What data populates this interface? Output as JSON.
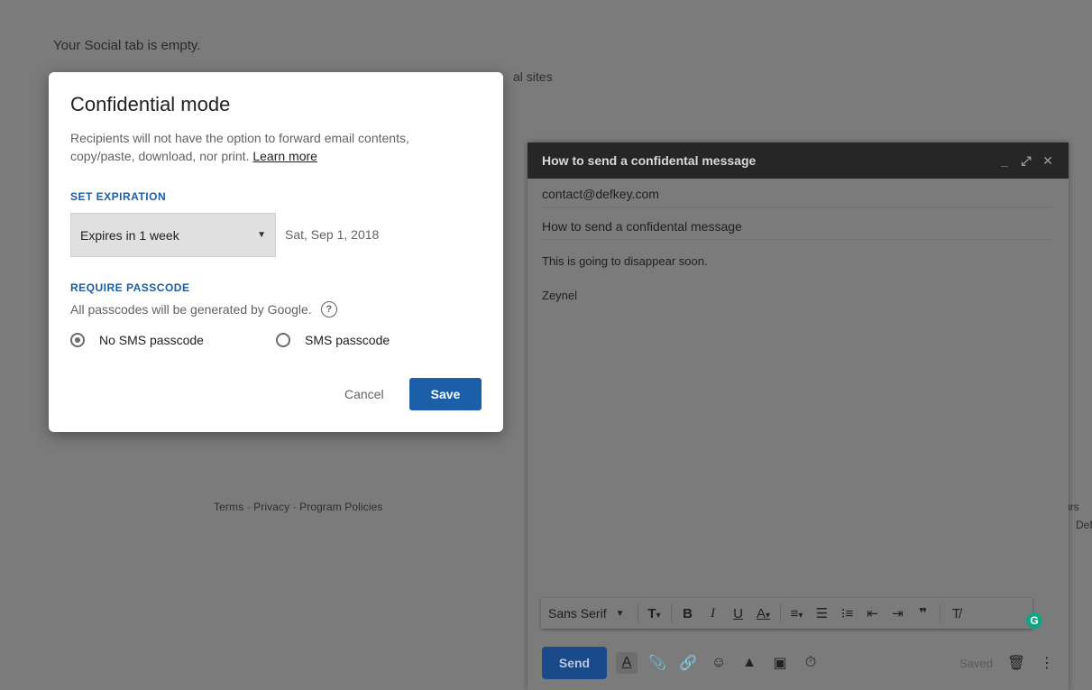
{
  "background": {
    "empty_message": "Your Social tab is empty.",
    "fragment_text": "al sites",
    "footer_links": [
      "Terms",
      "Privacy",
      "Program Policies"
    ],
    "footer_separator": " · ",
    "edge_text_a": "urs",
    "edge_text_b": "Def"
  },
  "compose": {
    "title": "How to send a confidental message",
    "to": "contact@defkey.com",
    "subject": "How to send a confidental message",
    "body_lines": [
      "This is going to disappear soon.",
      "Zeynel"
    ],
    "toolbar": {
      "font": "Sans Serif",
      "icons": [
        "font-size-icon",
        "bold-icon",
        "italic-icon",
        "underline-icon",
        "text-color-icon",
        "align-icon",
        "numbered-list-icon",
        "bulleted-list-icon",
        "indent-less-icon",
        "indent-more-icon",
        "quote-icon",
        "remove-formatting-icon"
      ]
    },
    "send_label": "Send",
    "saved_label": "Saved",
    "colors": {
      "header": "#262626",
      "send": "#1a4a8a"
    }
  },
  "dialog": {
    "title": "Confidential mode",
    "description": "Recipients will not have the option to forward email contents, copy/paste, download, nor print.",
    "learn_more": "Learn more",
    "expiration_header": "SET EXPIRATION",
    "expiration_value": "Expires in 1 week",
    "expiration_date": "Sat, Sep 1, 2018",
    "passcode_header": "REQUIRE PASSCODE",
    "passcode_note": "All passcodes will be generated by Google.",
    "options": [
      {
        "label": "No SMS passcode",
        "checked": true
      },
      {
        "label": "SMS passcode",
        "checked": false
      }
    ],
    "cancel_label": "Cancel",
    "save_label": "Save",
    "colors": {
      "accent": "#1a5fa8"
    }
  }
}
